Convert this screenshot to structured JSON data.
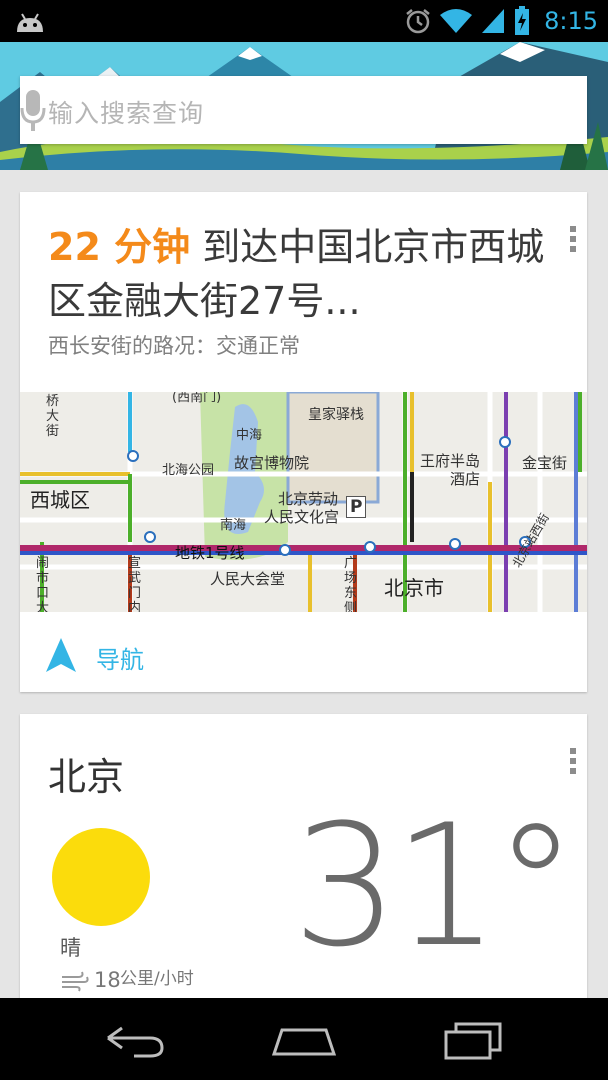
{
  "status_bar": {
    "time": "8:15",
    "icons": [
      "android-icon",
      "alarm-icon",
      "wifi-icon",
      "signal-icon",
      "battery-charging-icon"
    ]
  },
  "search": {
    "placeholder": "输入搜索查询"
  },
  "navigation_card": {
    "duration": "22 分钟",
    "destination": " 到达中国北京市西城区金融大街27号...",
    "traffic": "西长安街的路况：交通正常",
    "action_label": "导航",
    "map": {
      "labels": {
        "qiaodajie": "桥大街",
        "zhonghai": "中海",
        "huangjia": "皇家驿栈",
        "beihai": "北海公园",
        "gugong": "故宫博物院",
        "wangfu": "王府半岛",
        "jiudian": "酒店",
        "jinbao": "金宝街",
        "xicheng": "西城区",
        "laodong1": "北京劳动",
        "laodong2": "人民文化宫",
        "nanhai": "南海",
        "parking": "P",
        "subway": "地铁1号线",
        "xuanwu": "宣武门内",
        "renmin": "人民大会堂",
        "guangchang": "广场东侧",
        "beijingshi": "北京市",
        "naoshikou": "闹市口大",
        "zhanxi": "北京站西街",
        "tiananmen": "(西南门)"
      }
    }
  },
  "weather_card": {
    "city": "北京",
    "condition": "晴",
    "wind_speed": "18",
    "wind_unit": "公里/小时",
    "temperature": "31°"
  },
  "colors": {
    "accent": "#33b5e5",
    "duration": "#f48a1a",
    "sun": "#fbdc0c"
  }
}
